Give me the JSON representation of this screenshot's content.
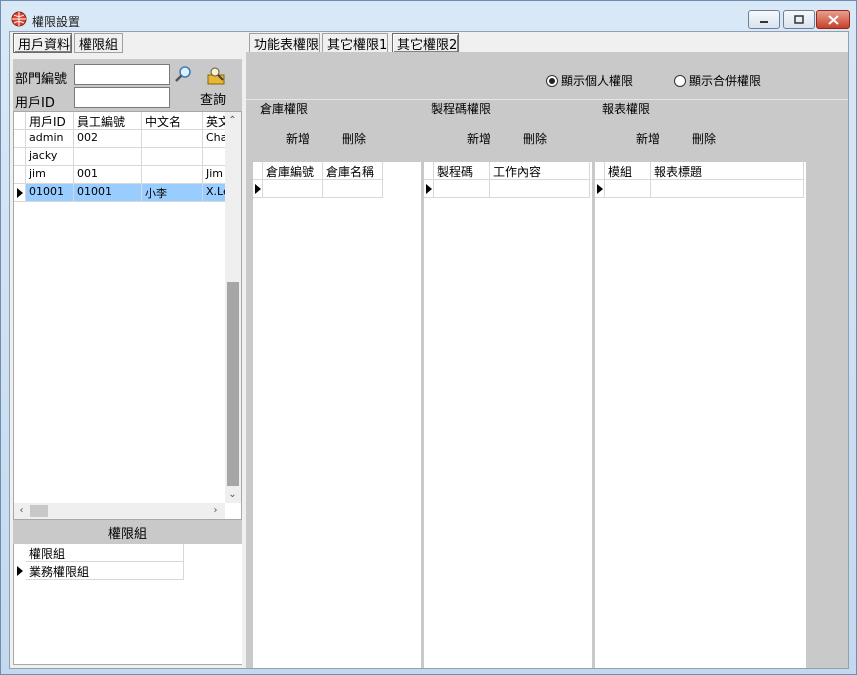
{
  "window": {
    "title": "權限設置"
  },
  "left_tabs": {
    "user_info": "用戶資料",
    "perm_group": "權限組"
  },
  "right_tabs": {
    "function_perm": "功能表權限",
    "other_perm1": "其它權限1",
    "other_perm2": "其它權限2"
  },
  "search": {
    "dept_label": "部門編號",
    "user_label": "用戶ID",
    "dept_value": "",
    "user_value": "",
    "query_label": "查詢",
    "icons": {
      "magnifier": "search-icon",
      "query": "query-icon"
    }
  },
  "users": {
    "headers": [
      "用戶ID",
      "員工編號",
      "中文名",
      "英文"
    ],
    "rows": [
      [
        "admin",
        "002",
        "",
        "Cha"
      ],
      [
        "jacky",
        "",
        "",
        ""
      ],
      [
        "jim",
        "001",
        "",
        "Jim"
      ],
      [
        "01001",
        "01001",
        "小李",
        "X.Le"
      ]
    ],
    "selected_index": 3
  },
  "perm_groups": {
    "bar_label": "權限組",
    "header": "權限組",
    "rows": [
      "業務權限組"
    ]
  },
  "display_options": [
    {
      "label": "顯示個人權限",
      "checked": true
    },
    {
      "label": "顯示合併權限",
      "checked": false
    }
  ],
  "panels": [
    {
      "title": "倉庫權限",
      "add": "新增",
      "delete": "刪除",
      "headers": [
        "倉庫編號",
        "倉庫名稱"
      ]
    },
    {
      "title": "製程碼權限",
      "add": "新增",
      "delete": "刪除",
      "headers": [
        "製程碼",
        "工作內容"
      ]
    },
    {
      "title": "報表權限",
      "add": "新增",
      "delete": "刪除",
      "headers": [
        "模組",
        "報表標題"
      ]
    }
  ],
  "colors": {
    "selected_row": "#99ccff",
    "close_button": "#c7402b"
  }
}
